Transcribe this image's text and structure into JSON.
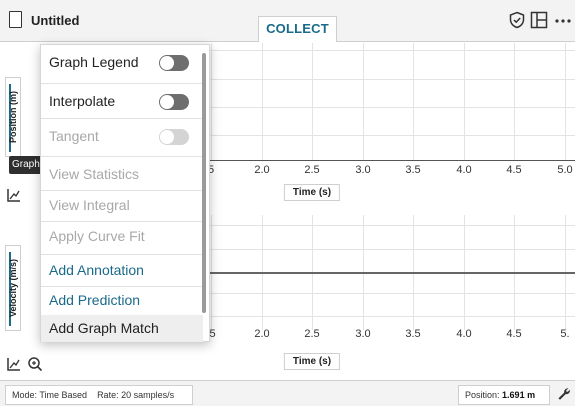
{
  "header": {
    "title": "Untitled",
    "tab_label": "COLLECT",
    "icons": [
      "file-icon",
      "shield-check-icon",
      "layout-icon",
      "more-icon"
    ]
  },
  "graph1": {
    "ylabel": "Position (m)",
    "xlabel": "Time (s)",
    "tab_label": "Graph",
    "x_ticks": [
      "2.0",
      "2.5",
      "3.0",
      "3.5",
      "4.0",
      "4.5",
      "5.0"
    ],
    "partial_tick": "5"
  },
  "graph2": {
    "ylabel": "Velocity (m/s)",
    "xlabel": "Time (s)",
    "x_ticks": [
      "2.0",
      "2.5",
      "3.0",
      "3.5",
      "4.0",
      "4.5",
      "5."
    ],
    "partial_tick": ".5"
  },
  "menu": {
    "items": [
      {
        "label": "Graph Legend",
        "state": "enabled",
        "toggle": "off"
      },
      {
        "label": "Interpolate",
        "state": "enabled",
        "toggle": "off"
      },
      {
        "label": "Tangent",
        "state": "disabled",
        "toggle": "off"
      },
      {
        "label": "View Statistics",
        "state": "disabled"
      },
      {
        "label": "View Integral",
        "state": "disabled"
      },
      {
        "label": "Apply Curve Fit",
        "state": "disabled"
      },
      {
        "label": "Add Annotation",
        "state": "enabled"
      },
      {
        "label": "Add Prediction",
        "state": "enabled"
      },
      {
        "label": "Add Graph Match",
        "state": "highlighted"
      }
    ]
  },
  "footer": {
    "mode_label": "Mode:",
    "mode_value": "Time Based",
    "rate_label": "Rate:",
    "rate_value": "20 samples/s",
    "position_label": "Position:",
    "position_value": "1.691 m"
  },
  "colors": {
    "accent": "#1a6a8a",
    "disabled_text": "#a8a8a8",
    "toggle_off": "#6e6e6e"
  }
}
